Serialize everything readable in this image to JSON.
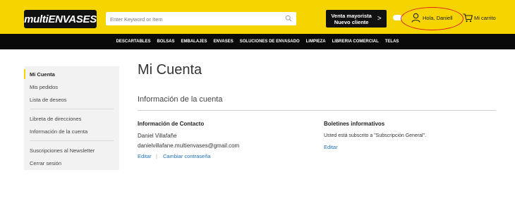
{
  "header": {
    "logo_text": "multiENVASES",
    "search": {
      "placeholder": "Enter Keyword or Item",
      "value": ""
    },
    "mayorista": {
      "line1": "Venta mayorista",
      "line2": "Nuevo cliente",
      "chevron": ">"
    },
    "greeting": "Hola, Daniell",
    "cart_label": "Mi carrito",
    "colors": {
      "brand_yellow": "#f5d400",
      "nav_black": "#0a0a0a",
      "highlight_red": "#e2231a"
    }
  },
  "nav": {
    "items": [
      "DESCARTABLES",
      "BOLSAS",
      "EMBALAJES",
      "ENVASES",
      "SOLUCIONES DE ENVASADO",
      "LIMPIEZA",
      "LIBRERIA COMERCIAL",
      "TELAS"
    ]
  },
  "sidebar": {
    "items": [
      {
        "label": "Mi Cuenta",
        "active": true
      },
      {
        "label": "Mis pedidos"
      },
      {
        "label": "Lista de deseos"
      },
      {
        "label": "Libreta de direcciones"
      },
      {
        "label": "Información de la cuenta"
      },
      {
        "label": "Suscripciones al Newsletter"
      },
      {
        "label": "Cerrar sesión"
      }
    ]
  },
  "main": {
    "title": "Mi Cuenta",
    "section_title": "Información de la cuenta",
    "contact": {
      "heading": "Información de Contacto",
      "name": "Daniel Villafañe",
      "email": "danielvillafane.multienvases@gmail.com",
      "edit_label": "Editar",
      "separator": "|",
      "change_password_label": "Cambiar contraseña"
    },
    "newsletter": {
      "heading": "Boletines informativos",
      "text": "Usted está subscrito a \"Subscripción General\".",
      "edit_label": "Editar"
    }
  }
}
